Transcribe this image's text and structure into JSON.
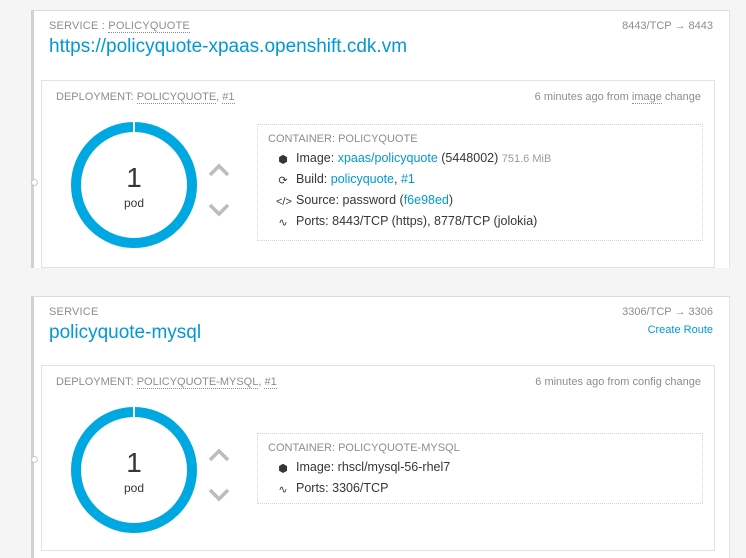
{
  "services": [
    {
      "label_prefix": "SERVICE :",
      "label_name": "POLICYQUOTE",
      "ports": "8443/TCP → 8443",
      "title": "https://policyquote-xpaas.openshift.cdk.vm",
      "deployment": {
        "label_prefix": "DEPLOYMENT:",
        "name": "POLICYQUOTE",
        "sep": ",",
        "number": "#1",
        "time_prefix": "6 minutes ago from",
        "time_trigger": "image",
        "time_suffix": "change",
        "pods": "1",
        "pod_unit": "pod",
        "container": {
          "label": "CONTAINER: POLICYQUOTE",
          "image_label": "Image:",
          "image_link": "xpaas/policyquote",
          "image_id": "(5448002)",
          "image_size": "751.6 MiB",
          "build_label": "Build:",
          "build_link": "policyquote",
          "build_sep": ",",
          "build_num": "#1",
          "source_label": "Source: password (",
          "source_commit": "f6e98ed",
          "source_close": ")",
          "ports": "Ports: 8443/TCP (https), 8778/TCP (jolokia)"
        }
      }
    },
    {
      "label": "SERVICE",
      "ports": "3306/TCP → 3306",
      "create_route": "Create Route",
      "title": "policyquote-mysql",
      "deployment": {
        "label_prefix": "DEPLOYMENT:",
        "name": "POLICYQUOTE-MYSQL",
        "sep": ",",
        "number": "#1",
        "time": "6 minutes ago from config change",
        "pods": "1",
        "pod_unit": "pod",
        "container": {
          "label": "CONTAINER: POLICYQUOTE-MYSQL",
          "image": "Image: rhscl/mysql-56-rhel7",
          "ports": "Ports: 3306/TCP"
        }
      }
    }
  ],
  "colors": {
    "accent": "#0099d3",
    "donut": "#00a8e1"
  },
  "icons": [
    "cube-icon",
    "refresh-icon",
    "code-icon",
    "pulse-icon",
    "chevron-up-icon",
    "chevron-down-icon"
  ]
}
